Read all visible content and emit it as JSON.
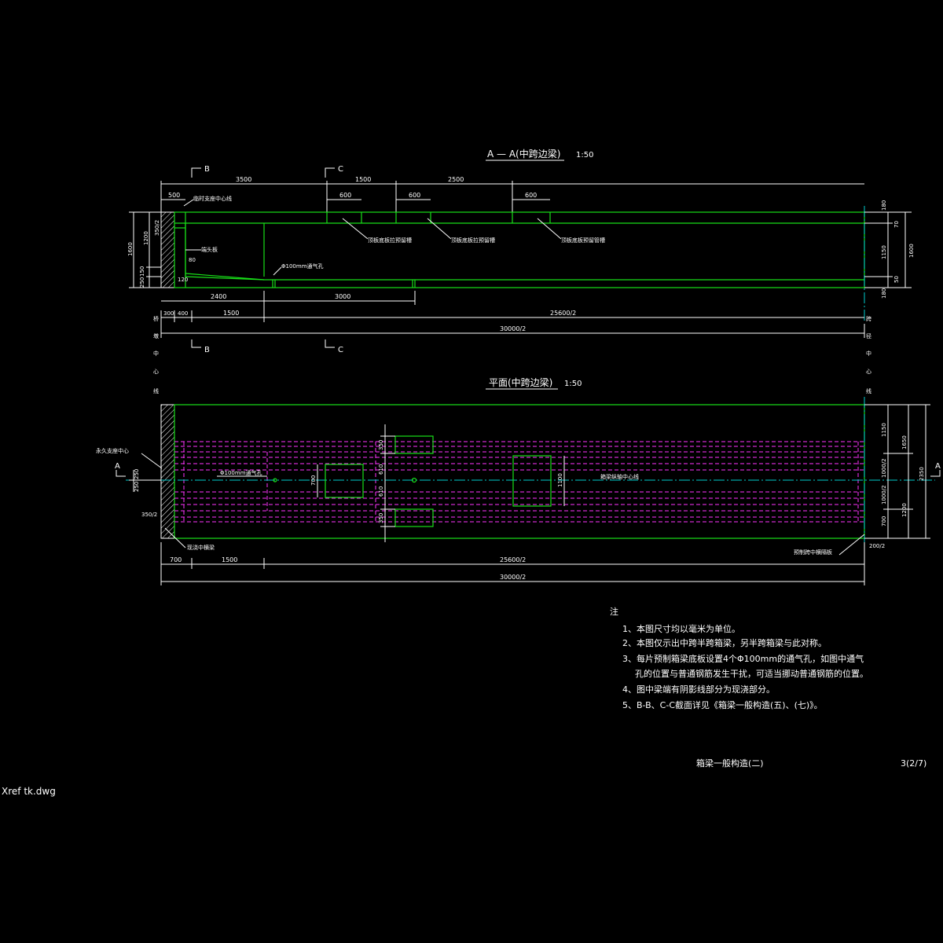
{
  "section_aa": {
    "title": "A — A(中跨边梁)",
    "scale": "1:50",
    "cut_b": "B",
    "cut_c": "C",
    "top_dims": [
      "3500",
      "1500",
      "2500"
    ],
    "sub_dims": [
      "500",
      "600",
      "600",
      "600"
    ],
    "labels": {
      "support_center": "临时支座中心线",
      "end_plate": "端头板",
      "vent_pipe": "Φ100mm通气孔",
      "bottom_groove1": "顶板底板拉预留槽",
      "bottom_groove2": "顶板底板拉预留槽",
      "top_pipe": "顶板底板预留管槽"
    },
    "left_dims": [
      "1600",
      "1200",
      "350/2",
      "150",
      "250",
      "80",
      "120"
    ],
    "right_dims": [
      "180",
      "70",
      "1150",
      "1600",
      "50",
      "180"
    ],
    "bottom_dims": [
      "2400",
      "3000",
      "300",
      "400",
      "1500",
      "25600/2",
      "30000/2"
    ],
    "side_text_left": [
      "桥",
      "墩",
      "中",
      "心",
      "线"
    ],
    "side_text_right": [
      "跨",
      "径",
      "中",
      "心",
      "线"
    ]
  },
  "plan": {
    "title": "平面(中跨边梁)",
    "scale": "1:50",
    "cut_a": "A",
    "labels": {
      "permanent_support": "永久支座中心",
      "vent_hole": "Φ100mm通气孔",
      "beam_axis": "箱梁纵轴中心线",
      "cast_diaphragm": "现浇中横梁",
      "prefab_plate": "预制跨中横隔板"
    },
    "left_dims": [
      "250",
      "250",
      "350/2"
    ],
    "inner_dims": [
      "350",
      "610",
      "610",
      "350",
      "700",
      "1100"
    ],
    "right_dims": [
      "1150",
      "1650",
      "1000/2",
      "1000/2",
      "2350",
      "700",
      "1200",
      "200/2"
    ],
    "bottom_dims": [
      "700",
      "1500",
      "25600/2",
      "30000/2"
    ]
  },
  "notes": {
    "heading": "注",
    "items": [
      "1、本图尺寸均以毫米为单位。",
      "2、本图仅示出中跨半跨箱梁，另半跨箱梁与此对称。",
      "3、每片预制箱梁底板设置4个Φ100mm的通气孔，如图中通气",
      "孔的位置与普通钢筋发生干扰，可适当挪动普通钢筋的位置。",
      "4、图中梁端有阴影线部分为现浇部分。",
      "5、B-B、C-C截面详见《箱梁一般构造(五)、(七)》。"
    ]
  },
  "title_block": {
    "name": "箱梁一般构造(二)",
    "sheet": "3(2/7)"
  },
  "xref": "Xref tk.dwg",
  "colors": {
    "outline": "#18e018",
    "tendon": "#ff33ff",
    "axis": "#00cccc",
    "dim": "#ffffff"
  }
}
